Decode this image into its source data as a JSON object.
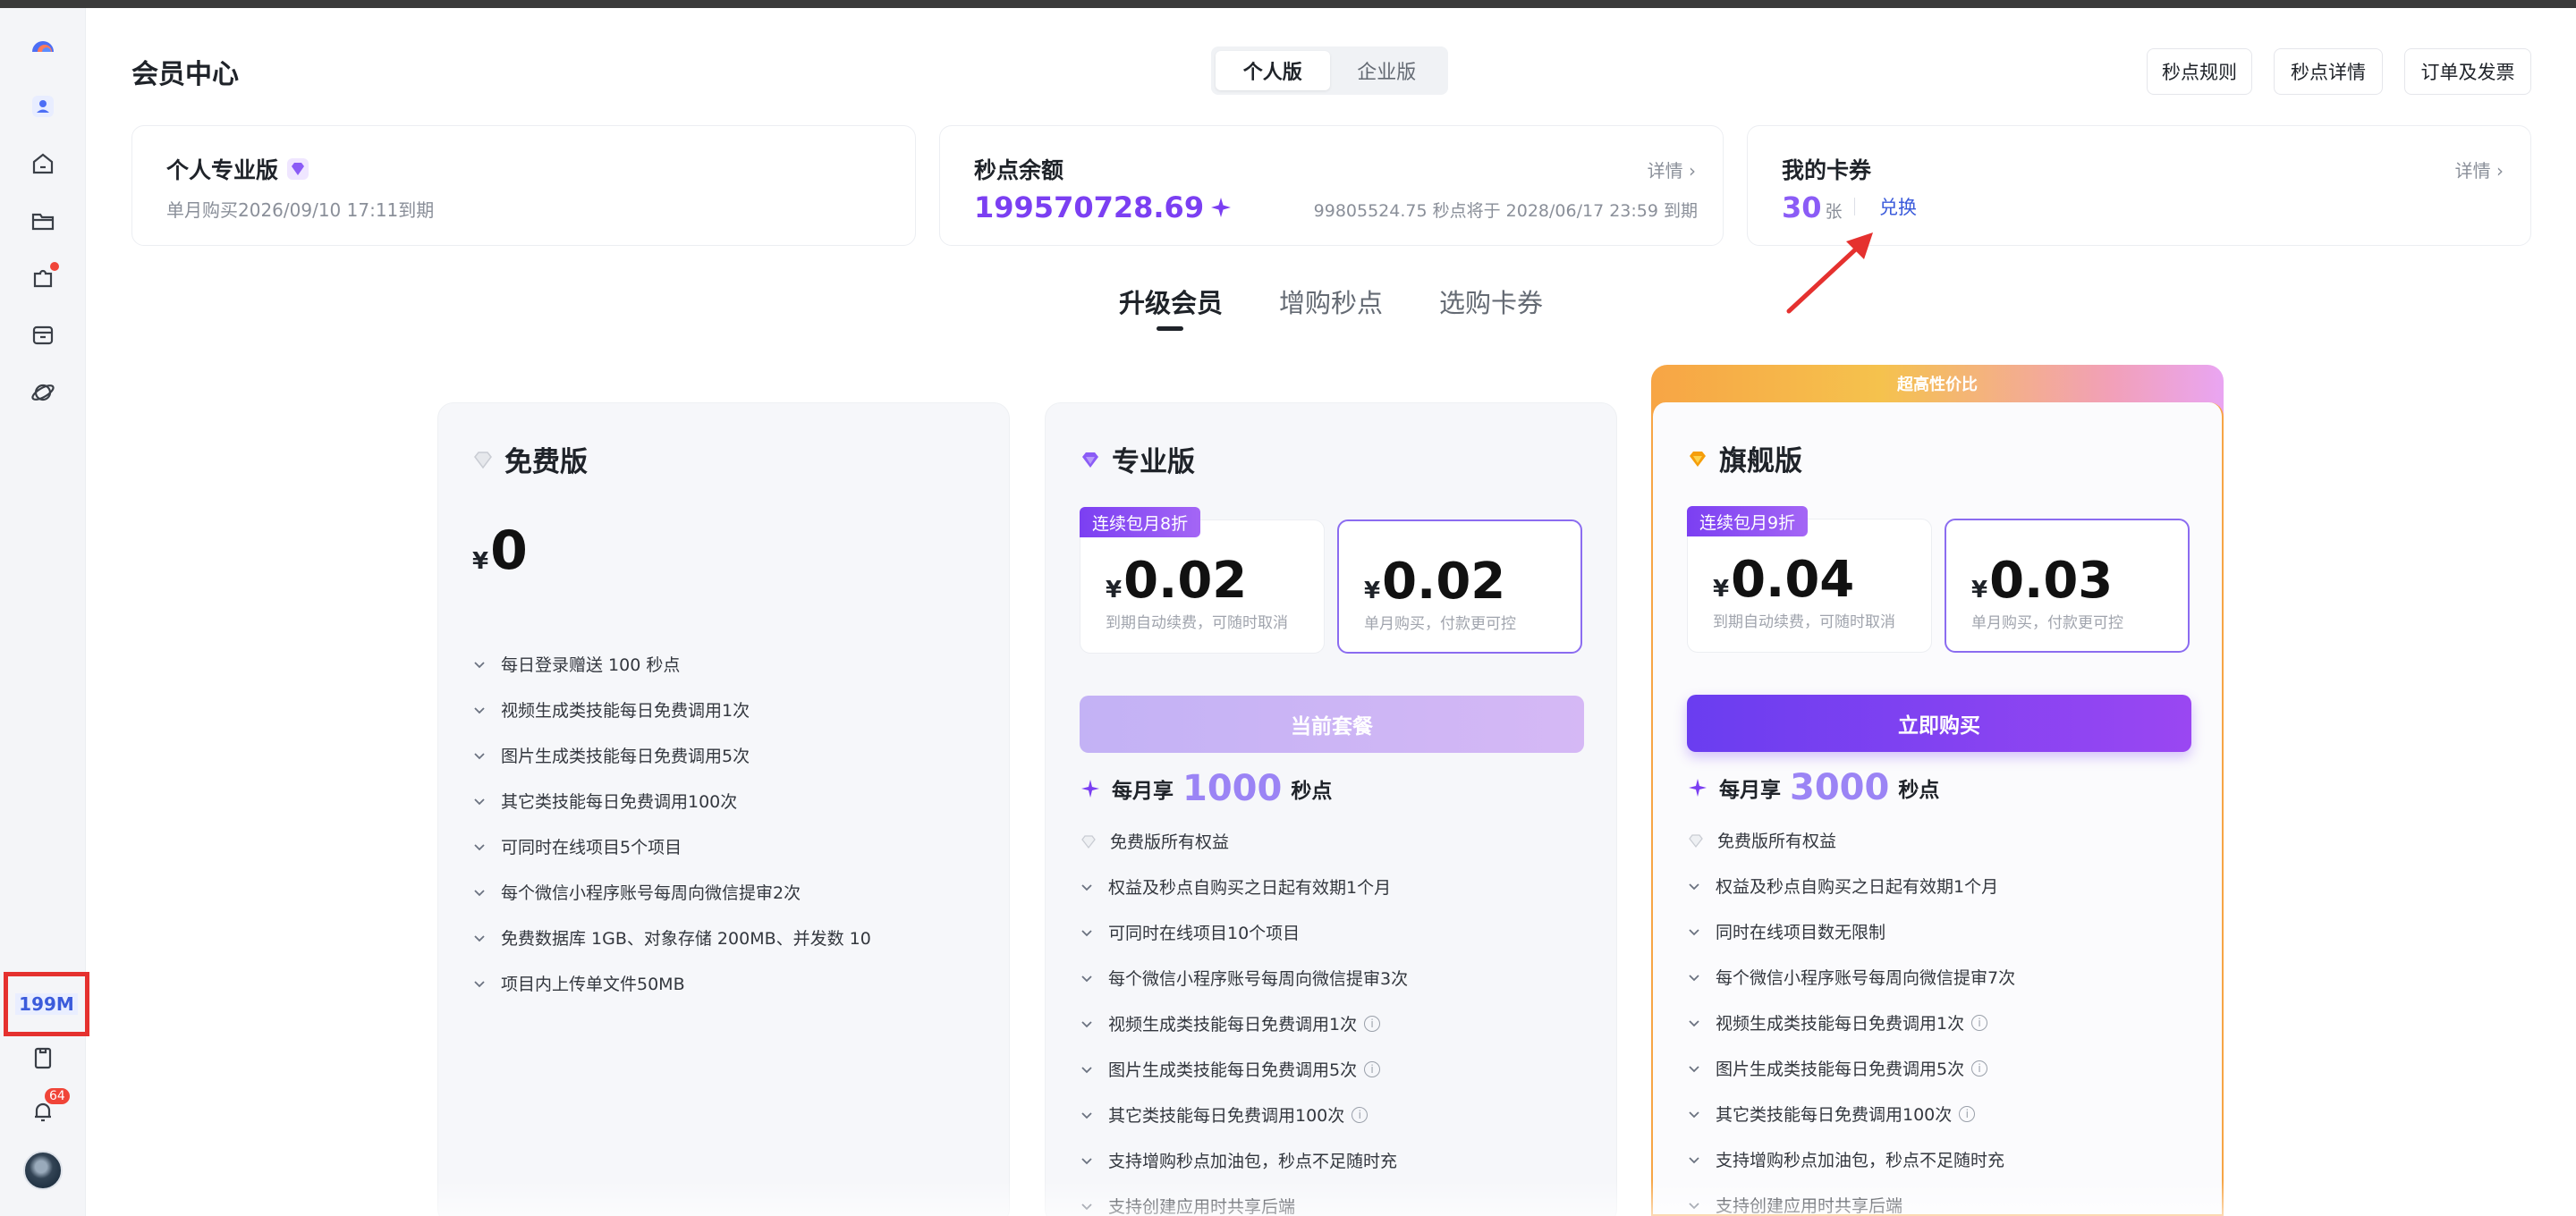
{
  "header": {
    "title": "会员中心",
    "edition_tabs": [
      "个人版",
      "企业版"
    ],
    "buttons": [
      "秒点规则",
      "秒点详情",
      "订单及发票"
    ]
  },
  "sidebar": {
    "points_label": "199M",
    "notification_badge": "64"
  },
  "summary": {
    "plan_card": {
      "title": "个人专业版",
      "subtitle": "单月购买2026/09/10 17:11到期"
    },
    "balance_card": {
      "title": "秒点余额",
      "detail": "详情",
      "balance": "199570728.69",
      "expire_note": "99805524.75 秒点将于 2028/06/17 23:59 到期"
    },
    "coupon_card": {
      "title": "我的卡券",
      "detail": "详情",
      "count": "30",
      "unit": "张",
      "redeem": "兑换"
    }
  },
  "tabs": [
    "升级会员",
    "增购秒点",
    "选购卡券"
  ],
  "plans": {
    "free": {
      "name": "免费版",
      "currency": "¥",
      "price": "0",
      "features": [
        "每日登录赠送 100 秒点",
        "视频生成类技能每日免费调用1次",
        "图片生成类技能每日免费调用5次",
        "其它类技能每日免费调用100次",
        "可同时在线项目5个项目",
        "每个微信小程序账号每周向微信提审2次",
        "免费数据库 1GB、对象存储 200MB、并发数 10",
        "项目内上传单文件50MB"
      ]
    },
    "pro": {
      "name": "专业版",
      "badge": "连续包月8折",
      "currency": "¥",
      "auto_price": "0.02",
      "auto_note": "到期自动续费，可随时取消",
      "single_price": "0.02",
      "single_note": "单月购买，付款更可控",
      "button": "当前套餐",
      "monthly_prefix": "每月享",
      "monthly_points": "1000",
      "monthly_suffix": "秒点",
      "features": [
        "免费版所有权益",
        "权益及秒点自购买之日起有效期1个月",
        "可同时在线项目10个项目",
        "每个微信小程序账号每周向微信提审3次",
        "视频生成类技能每日免费调用1次",
        "图片生成类技能每日免费调用5次",
        "其它类技能每日免费调用100次",
        "支持增购秒点加油包，秒点不足随时充",
        "支持创建应用时共享后端"
      ]
    },
    "flagship": {
      "flag": "超高性价比",
      "name": "旗舰版",
      "badge": "连续包月9折",
      "currency": "¥",
      "auto_price": "0.04",
      "auto_note": "到期自动续费，可随时取消",
      "single_price": "0.03",
      "single_note": "单月购买，付款更可控",
      "button": "立即购买",
      "monthly_prefix": "每月享",
      "monthly_points": "3000",
      "monthly_suffix": "秒点",
      "features": [
        "免费版所有权益",
        "权益及秒点自购买之日起有效期1个月",
        "同时在线项目数无限制",
        "每个微信小程序账号每周向微信提审7次",
        "视频生成类技能每日免费调用1次",
        "图片生成类技能每日免费调用5次",
        "其它类技能每日免费调用100次",
        "支持增购秒点加油包，秒点不足随时充",
        "支持创建应用时共享后端"
      ]
    }
  },
  "colors": {
    "accent": "#7b3ff2",
    "link": "#3b5bdb",
    "highlight_box": "#e5312f"
  }
}
